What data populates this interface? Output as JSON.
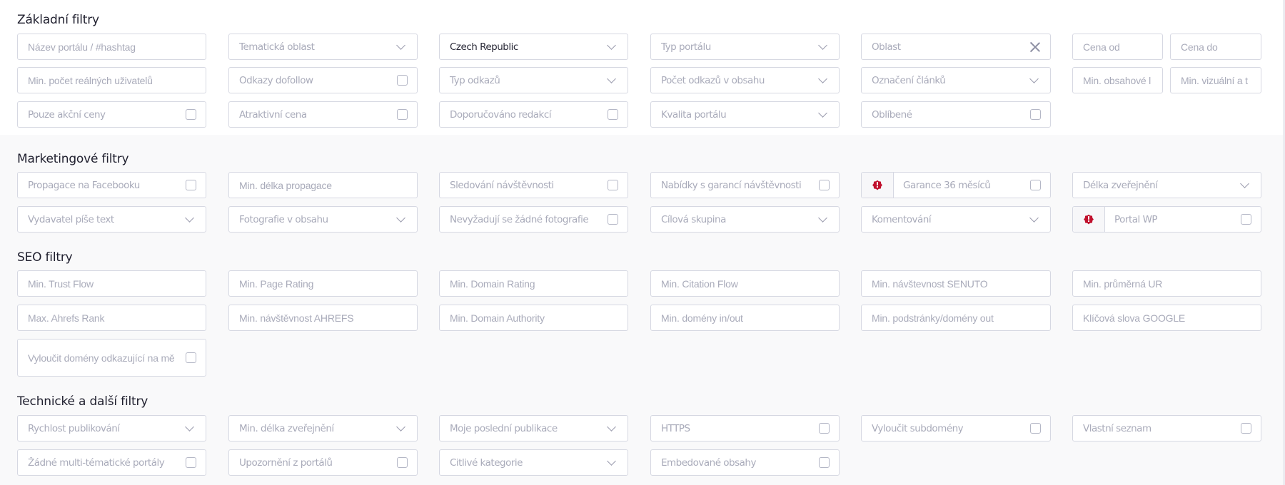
{
  "sections": {
    "basic": {
      "title": "Základní filtry",
      "fields": {
        "portal_name": {
          "placeholder": "Název portálu / #hashtag",
          "kind": "text"
        },
        "topic_area": {
          "placeholder": "Tematická oblast",
          "kind": "select"
        },
        "country": {
          "value": "Czech Republic",
          "kind": "select"
        },
        "portal_type": {
          "placeholder": "Typ portálu",
          "kind": "select"
        },
        "region": {
          "placeholder": "Oblast",
          "kind": "select-clearable"
        },
        "price_from": {
          "placeholder": "Cena od",
          "kind": "text"
        },
        "price_to": {
          "placeholder": "Cena do",
          "kind": "text"
        },
        "min_real_users": {
          "placeholder": "Min. počet reálných uživatelů",
          "kind": "text"
        },
        "dofollow_links": {
          "label": "Odkazy dofollow",
          "kind": "checkbox",
          "checked": false
        },
        "link_type": {
          "placeholder": "Typ odkazů",
          "kind": "select"
        },
        "links_in_content": {
          "placeholder": "Počet odkazů v obsahu",
          "kind": "select"
        },
        "article_marking": {
          "placeholder": "Označení článků",
          "kind": "select"
        },
        "min_content": {
          "placeholder": "Min. obsahové l",
          "kind": "text"
        },
        "min_visual": {
          "placeholder": "Min. vizuální a t",
          "kind": "text"
        },
        "sale_prices_only": {
          "label": "Pouze akční ceny",
          "kind": "checkbox",
          "checked": false
        },
        "attractive_price": {
          "label": "Atraktivní cena",
          "kind": "checkbox",
          "checked": false
        },
        "editor_recommended": {
          "label": "Doporučováno redakcí",
          "kind": "checkbox",
          "checked": false
        },
        "portal_quality": {
          "placeholder": "Kvalita portálu",
          "kind": "select"
        },
        "favorites": {
          "label": "Oblíbené",
          "kind": "checkbox",
          "checked": false
        }
      }
    },
    "marketing": {
      "title": "Marketingové filtry",
      "fields": {
        "facebook_promo": {
          "label": "Propagace na Facebooku",
          "kind": "checkbox",
          "checked": false
        },
        "min_promo_length": {
          "placeholder": "Min. délka propagace",
          "kind": "text"
        },
        "traffic_tracking": {
          "label": "Sledování návštěvnosti",
          "kind": "checkbox",
          "checked": false
        },
        "guaranteed_traffic": {
          "label": "Nabídky s garancí návštěvnosti",
          "kind": "checkbox",
          "checked": false
        },
        "guarantee_36": {
          "label": "Garance 36 měsíců",
          "kind": "checkbox",
          "checked": false,
          "icon": "alert-badge-icon"
        },
        "publish_length": {
          "placeholder": "Délka zveřejnění",
          "kind": "select"
        },
        "publisher_writes": {
          "placeholder": "Vydavatel píše text",
          "kind": "select"
        },
        "photos_in_content": {
          "placeholder": "Fotografie v obsahu",
          "kind": "select"
        },
        "no_photos_required": {
          "label": "Nevyžadují se žádné fotografie",
          "kind": "checkbox",
          "checked": false
        },
        "target_group": {
          "placeholder": "Cílová skupina",
          "kind": "select"
        },
        "commenting": {
          "placeholder": "Komentování",
          "kind": "select"
        },
        "portal_wp": {
          "label": "Portal WP",
          "kind": "checkbox",
          "checked": false,
          "icon": "alert-badge-icon"
        }
      }
    },
    "seo": {
      "title": "SEO filtry",
      "fields": {
        "min_trust_flow": {
          "placeholder": "Min. Trust Flow"
        },
        "min_page_rating": {
          "placeholder": "Min. Page Rating"
        },
        "min_domain_rating": {
          "placeholder": "Min. Domain Rating"
        },
        "min_citation_flow": {
          "placeholder": "Min. Citation Flow"
        },
        "min_senuto": {
          "placeholder": "Min. návštevnost SENUTO"
        },
        "min_avg_ur": {
          "placeholder": "Min. průměrná UR"
        },
        "max_ahrefs_rank": {
          "placeholder": "Max. Ahrefs Rank"
        },
        "min_ahrefs_traffic": {
          "placeholder": "Min. návštěvnost AHREFS"
        },
        "min_domain_authority": {
          "placeholder": "Min. Domain Authority"
        },
        "min_domains_inout": {
          "placeholder": "Min. domény in/out"
        },
        "min_subpages_out": {
          "placeholder": "Min. podstránky/domény out"
        },
        "google_keywords": {
          "placeholder": "Klíčová slova GOOGLE"
        },
        "exclude_linking": {
          "label": "Vyloučit domény odkazující na mě",
          "kind": "checkbox",
          "checked": false
        }
      }
    },
    "technical": {
      "title": "Technické a další filtry",
      "fields": {
        "publish_speed": {
          "placeholder": "Rychlost publikování",
          "kind": "select"
        },
        "min_publish_length": {
          "placeholder": "Min. délka zveřejnění",
          "kind": "select"
        },
        "my_last_publications": {
          "placeholder": "Moje poslední publikace",
          "kind": "select"
        },
        "https": {
          "label": "HTTPS",
          "kind": "checkbox",
          "checked": false
        },
        "exclude_subdomains": {
          "label": "Vyloučit subdomény",
          "kind": "checkbox",
          "checked": false
        },
        "own_list": {
          "label": "Vlastní seznam",
          "kind": "checkbox",
          "checked": false
        },
        "no_multitopic": {
          "label": "Žádné multi-tématické portály",
          "kind": "checkbox",
          "checked": false
        },
        "portal_warnings": {
          "label": "Upozornění z portálů",
          "kind": "checkbox",
          "checked": false
        },
        "sensitive_categories": {
          "placeholder": "Citlivé kategorie",
          "kind": "select"
        },
        "embedded_content": {
          "label": "Embedované obsahy",
          "kind": "checkbox",
          "checked": false
        }
      }
    }
  },
  "icons": {
    "alert_badge": "!"
  },
  "colors": {
    "alert_badge": "#c0102d",
    "border": "#d6d8e2",
    "placeholder": "#a9abba",
    "title": "#1f1f2e"
  }
}
